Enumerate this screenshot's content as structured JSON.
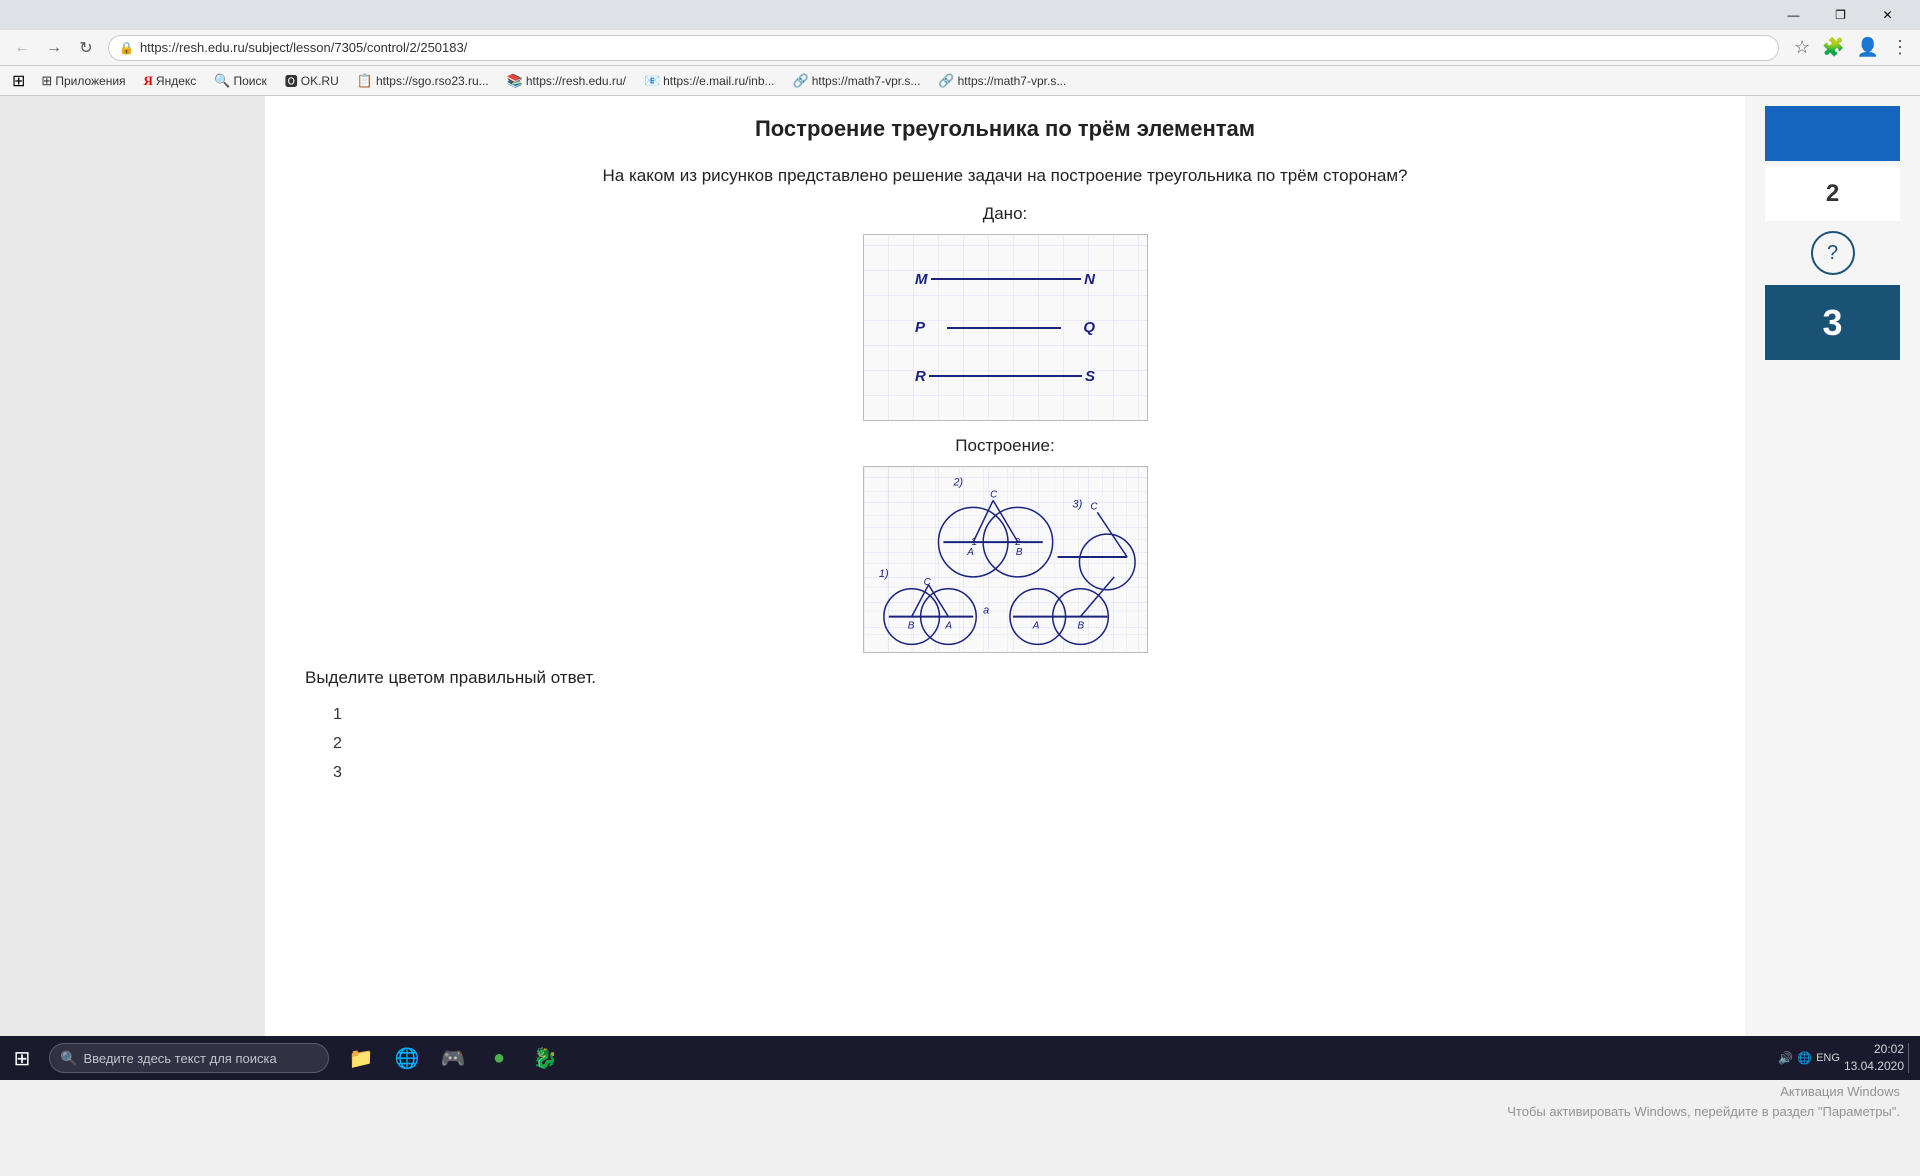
{
  "browser": {
    "url": "resh.edu.ru/subject/lesson/7305/control/2/250183/",
    "full_url": "https://resh.edu.ru/subject/lesson/7305/control/2/250183/",
    "window_controls": {
      "minimize": "—",
      "maximize": "❐",
      "close": "✕"
    },
    "bookmarks": [
      {
        "label": "Приложения",
        "icon": "⊞"
      },
      {
        "label": "Яндекс",
        "icon": "Я"
      },
      {
        "label": "Поиск",
        "icon": "🔍"
      },
      {
        "label": "OK.RU",
        "icon": "ОК"
      },
      {
        "label": "https://sgo.rso23.ru...",
        "icon": "📋"
      },
      {
        "label": "https://resh.edu.ru/",
        "icon": "📚"
      },
      {
        "label": "https://e.mail.ru/inb...",
        "icon": "📧"
      },
      {
        "label": "https://math7-vpr.s...",
        "icon": "🔗"
      },
      {
        "label": "https://math7-vpr.s...",
        "icon": "🔗"
      }
    ]
  },
  "page": {
    "title": "Построение треугольника по трём элементам",
    "question_text": "На каком из рисунков представлено решение задачи на построение треугольника по трём сторонам?",
    "given_label": "Дано:",
    "construction_label": "Построение:",
    "select_answer_text": "Выделите цветом правильный ответ.",
    "answers": [
      "1",
      "2",
      "3"
    ],
    "segments": [
      {
        "left": "M",
        "right": "N"
      },
      {
        "left": "P",
        "right": "Q"
      },
      {
        "left": "R",
        "right": "S"
      }
    ]
  },
  "sidebar_right": {
    "question_number": "2",
    "active_question": "3",
    "help_icon": "?"
  },
  "taskbar": {
    "search_placeholder": "Введите здесь текст для поиска",
    "time": "20:02",
    "date": "13.04.2020",
    "language": "ENG"
  },
  "windows_activation": {
    "line1": "Активация Windows",
    "line2": "Чтобы активировать Windows, перейдите в раздел \"Параметры\"."
  }
}
